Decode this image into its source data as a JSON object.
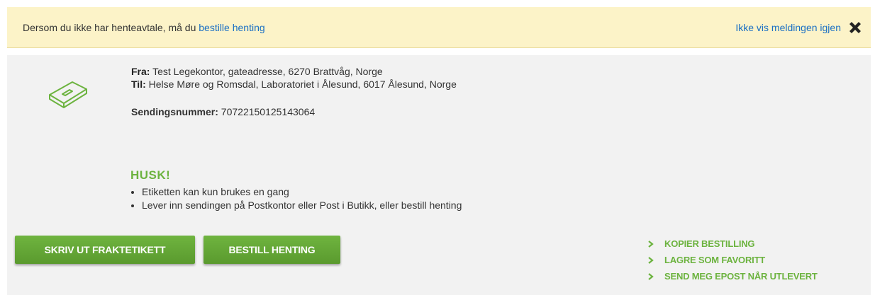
{
  "notice": {
    "text": "Dersom du ikke har henteavtale, må du",
    "link": "bestille henting",
    "dismiss": "Ikke vis meldingen igjen",
    "close_icon": "close-x-icon"
  },
  "shipment": {
    "from_label": "Fra:",
    "from_value": "Test Legekontor, gateadresse, 6270 Brattvåg, Norge",
    "to_label": "Til:",
    "to_value": "Helse Møre og Romsdal, Laboratoriet i Ålesund, 6017 Ålesund, Norge",
    "number_label": "Sendingsnummer:",
    "number_value": "70722150125143064",
    "icon": "package-icon"
  },
  "reminder": {
    "title": "HUSK!",
    "items": [
      "Etiketten kan kun brukes en gang",
      "Lever inn sendingen på Postkontor eller Post i Butikk, eller bestill henting"
    ]
  },
  "buttons": {
    "print": "SKRIV UT FRAKTETIKETT",
    "pickup": "BESTILL HENTING"
  },
  "actions": [
    "KOPIER BESTILLING",
    "LAGRE SOM FAVORITT",
    "SEND MEG EPOST NÅR UTLEVERT"
  ],
  "colors": {
    "notice_bg": "#fcf3c8",
    "link": "#1a6fc4",
    "accent_green": "#6cb33f",
    "panel_bg": "#f2f2f2"
  }
}
